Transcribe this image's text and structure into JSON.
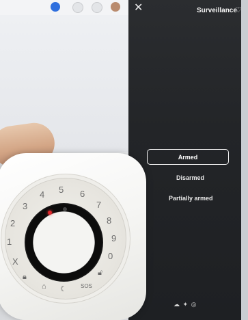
{
  "phone": {
    "title": "Surveillance",
    "close_icon": "close-icon",
    "favorite_icon": "heart-icon",
    "modes": {
      "armed": "Armed",
      "disarmed": "Disarmed",
      "partially_armed": "Partially armed"
    },
    "bottom_icons": [
      "cloud-icon",
      "gear-icon",
      "shield-icon"
    ]
  },
  "keypad": {
    "digits": [
      "1",
      "2",
      "3",
      "4",
      "5",
      "6",
      "7",
      "8",
      "9",
      "0"
    ],
    "cancel": "X",
    "sos": "SOS",
    "lock_icons": [
      "lock-icon",
      "home-icon",
      "moon-icon"
    ]
  },
  "colors": {
    "phone_bg": "#232528",
    "led_red": "#e0262b",
    "text_light": "#f4f4f4"
  }
}
